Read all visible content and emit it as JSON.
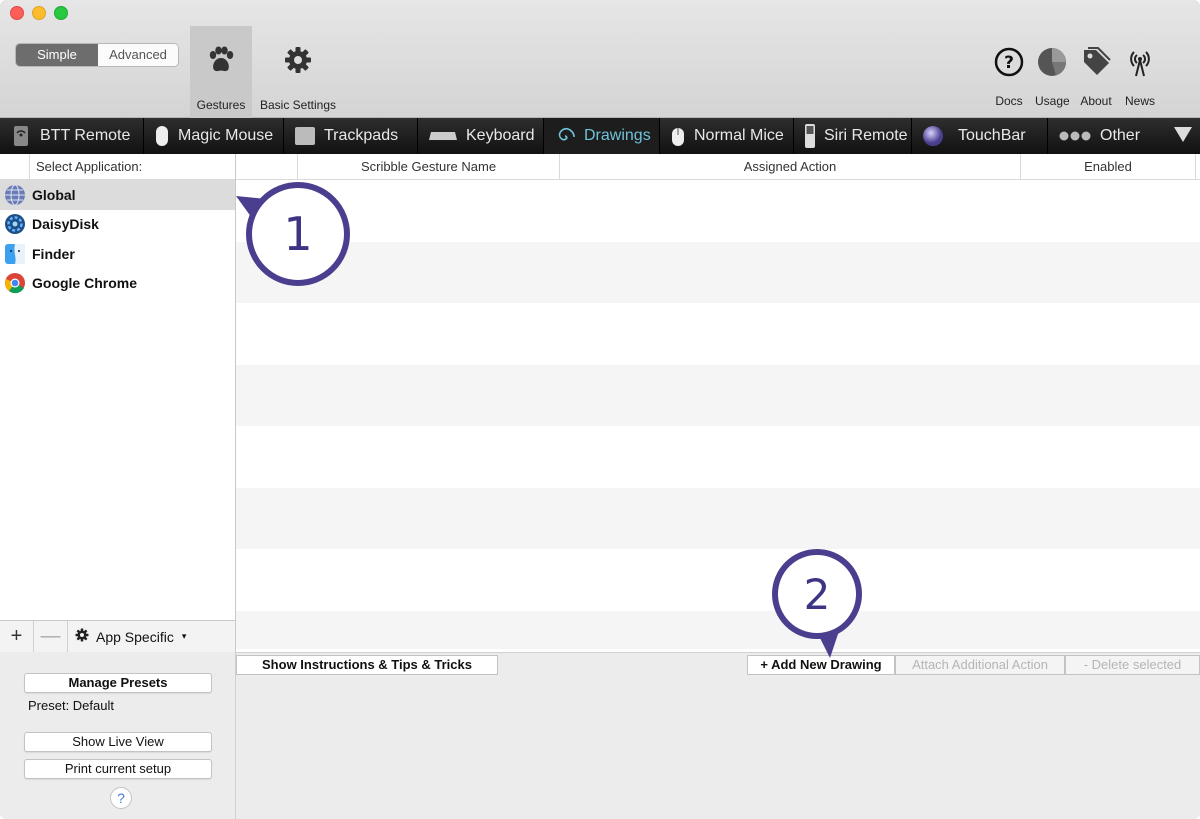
{
  "toolbar": {
    "mode_simple": "Simple",
    "mode_advanced": "Advanced",
    "gestures_label": "Gestures",
    "basic_settings_label": "Basic Settings",
    "docs_label": "Docs",
    "usage_label": "Usage",
    "about_label": "About",
    "news_label": "News"
  },
  "tabs": [
    {
      "label": "BTT Remote",
      "icon": "remote-icon"
    },
    {
      "label": "Magic Mouse",
      "icon": "magic-mouse-icon"
    },
    {
      "label": "Trackpads",
      "icon": "trackpad-icon"
    },
    {
      "label": "Keyboard",
      "icon": "keyboard-icon"
    },
    {
      "label": "Drawings",
      "icon": "spiral-icon",
      "active": true
    },
    {
      "label": "Normal Mice",
      "icon": "mouse-icon"
    },
    {
      "label": "Siri Remote",
      "icon": "siri-remote-icon"
    },
    {
      "label": "TouchBar",
      "icon": "touchbar-icon"
    },
    {
      "label": "Other",
      "icon": "dots-icon"
    }
  ],
  "app_list": {
    "header": "Select Application:",
    "items": [
      {
        "name": "Global",
        "icon": "globe-icon",
        "selected": true
      },
      {
        "name": "DaisyDisk",
        "icon": "daisydisk-icon"
      },
      {
        "name": "Finder",
        "icon": "finder-icon"
      },
      {
        "name": "Google Chrome",
        "icon": "chrome-icon"
      }
    ],
    "add_label": "+",
    "remove_label": "—",
    "app_specific_label": "App Specific",
    "app_specific_caret": "▾"
  },
  "presets": {
    "manage_label": "Manage Presets",
    "preset_text": "Preset: Default",
    "live_view_label": "Show Live View",
    "print_label": "Print current setup",
    "help_label": "?"
  },
  "table": {
    "columns": [
      "",
      "Scribble Gesture Name",
      "Assigned Action",
      "Enabled"
    ]
  },
  "bottom_buttons": {
    "instructions": "Show Instructions & Tips & Tricks",
    "add_drawing": "+ Add New Drawing",
    "attach_action": "Attach Additional Action",
    "delete_selected": "- Delete selected"
  },
  "callouts": {
    "one": "1",
    "two": "2"
  },
  "colors": {
    "callout": "#4a3f8f",
    "active_tab": "#6fc3d8"
  }
}
